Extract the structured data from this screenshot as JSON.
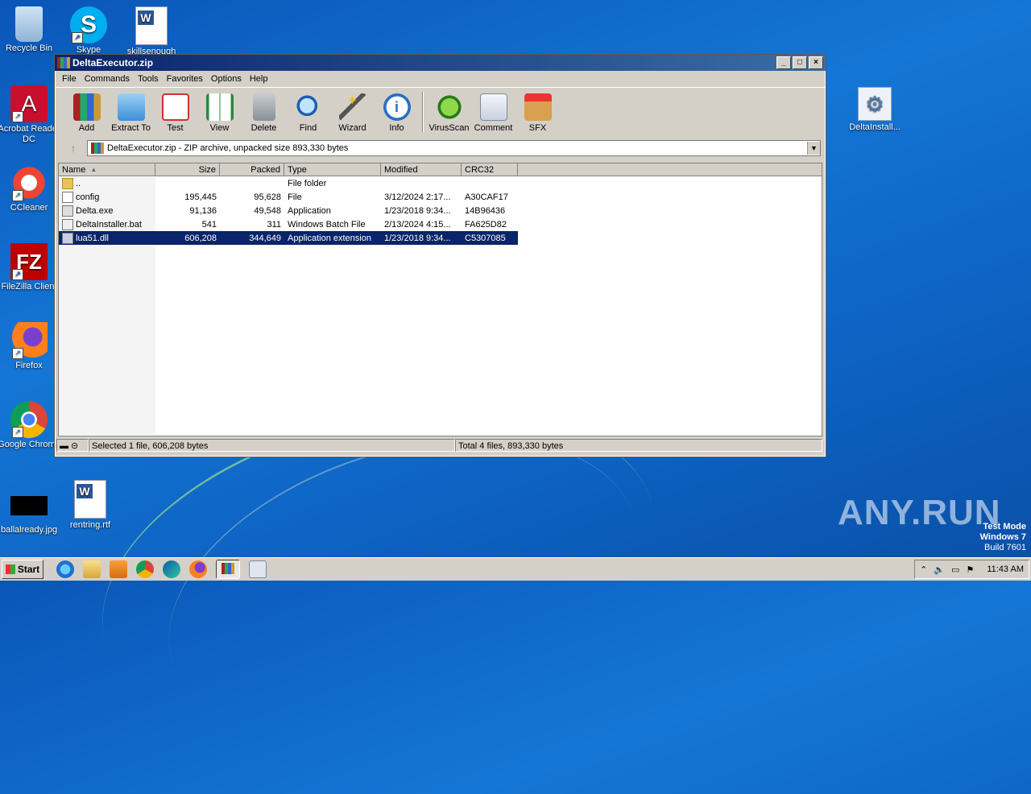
{
  "desktop": {
    "icons": [
      {
        "label": "Recycle Bin"
      },
      {
        "label": "Skype"
      },
      {
        "label": "skillsenough"
      },
      {
        "label": "Acrobat Reader DC"
      },
      {
        "label": "CCleaner"
      },
      {
        "label": "FileZilla Client"
      },
      {
        "label": "Firefox"
      },
      {
        "label": "Google Chrome"
      },
      {
        "label": "ballalready.jpg"
      },
      {
        "label": "rentring.rtf"
      },
      {
        "label": "DeltaInstall..."
      }
    ],
    "watermark": "ANY.RUN",
    "test_mode": {
      "line1": "Test Mode",
      "line2": "Windows 7",
      "line3": "Build 7601"
    }
  },
  "window": {
    "title": "DeltaExecutor.zip",
    "menu": [
      "File",
      "Commands",
      "Tools",
      "Favorites",
      "Options",
      "Help"
    ],
    "toolbar": [
      "Add",
      "Extract To",
      "Test",
      "View",
      "Delete",
      "Find",
      "Wizard",
      "Info",
      "VirusScan",
      "Comment",
      "SFX"
    ],
    "address": "DeltaExecutor.zip - ZIP archive, unpacked size 893,330 bytes",
    "columns": [
      "Name",
      "Size",
      "Packed",
      "Type",
      "Modified",
      "CRC32"
    ],
    "files": [
      {
        "name": "..",
        "size": "",
        "packed": "",
        "type": "File folder",
        "modified": "",
        "crc": ""
      },
      {
        "name": "config",
        "size": "195,445",
        "packed": "95,628",
        "type": "File",
        "modified": "3/12/2024 2:17...",
        "crc": "A30CAF17"
      },
      {
        "name": "Delta.exe",
        "size": "91,136",
        "packed": "49,548",
        "type": "Application",
        "modified": "1/23/2018 9:34...",
        "crc": "14B96436"
      },
      {
        "name": "DeltaInstaller.bat",
        "size": "541",
        "packed": "311",
        "type": "Windows Batch File",
        "modified": "2/13/2024 4:15...",
        "crc": "FA625D82"
      },
      {
        "name": "lua51.dll",
        "size": "606,208",
        "packed": "344,649",
        "type": "Application extension",
        "modified": "1/23/2018 9:34...",
        "crc": "C5307085"
      }
    ],
    "status_left": "Selected 1 file, 606,208 bytes",
    "status_right": "Total 4 files, 893,330 bytes"
  },
  "taskbar": {
    "start": "Start",
    "clock": "11:43 AM"
  }
}
